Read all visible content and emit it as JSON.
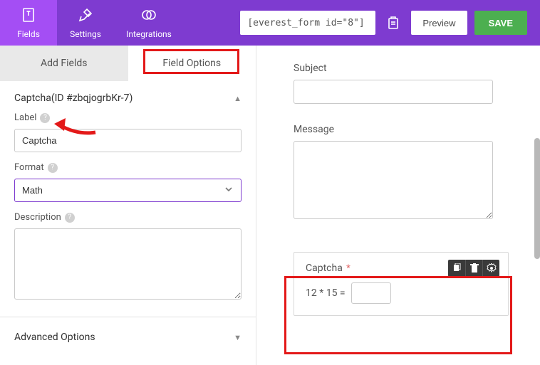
{
  "topnav": {
    "fields": "Fields",
    "settings": "Settings",
    "integrations": "Integrations"
  },
  "shortcode": {
    "value": "[everest_form id=\"8\"]"
  },
  "buttons": {
    "preview": "Preview",
    "save": "SAVE"
  },
  "sidetabs": {
    "add_fields": "Add Fields",
    "field_options": "Field Options"
  },
  "panel": {
    "title": "Captcha(ID #zbqjogrbKr-7)"
  },
  "label_field": {
    "label": "Label",
    "value": "Captcha"
  },
  "format_field": {
    "label": "Format",
    "value": "Math"
  },
  "description_field": {
    "label": "Description",
    "value": ""
  },
  "advanced": {
    "label": "Advanced Options"
  },
  "canvas": {
    "subject_label": "Subject",
    "message_label": "Message",
    "captcha_label": "Captcha",
    "captcha_question": "12 * 15 ="
  }
}
